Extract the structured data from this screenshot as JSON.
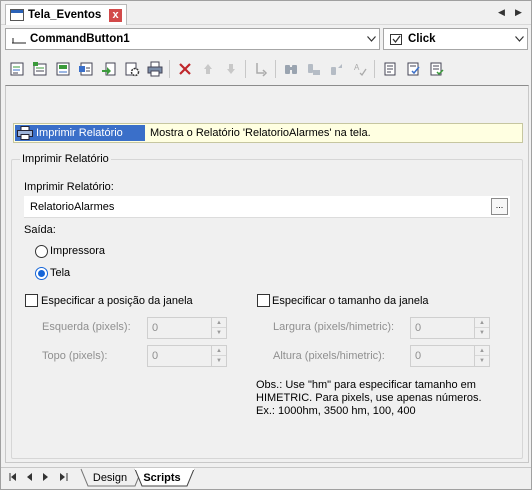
{
  "window": {
    "tab_title": "Tela_Eventos",
    "close_glyph": "x",
    "nav_prev": "◀",
    "nav_next": "▶"
  },
  "selectors": {
    "object": "CommandButton1",
    "event": "Click"
  },
  "toolbar": {
    "icons": [
      "add-script-icon",
      "add-user-script-icon",
      "add-action-icon",
      "add-item-icon",
      "import-icon",
      "settings-icon",
      "print-icon",
      "delete-icon",
      "move-up-icon",
      "move-down-icon",
      "goto-icon",
      "find-icon",
      "find-next-icon",
      "replace-icon",
      "spell-icon",
      "view-script-icon",
      "view-script-check-icon",
      "view-script-list-icon"
    ]
  },
  "action": {
    "name": "Imprimir Relatório",
    "description": "Mostra o Relatório 'RelatorioAlarmes' na tela."
  },
  "form": {
    "group_title": "Imprimir Relatório",
    "report_label": "Imprimir Relatório:",
    "report_value": "RelatorioAlarmes",
    "browse_label": "...",
    "output_label": "Saída:",
    "output_options": [
      {
        "label": "Impressora",
        "selected": false
      },
      {
        "label": "Tela",
        "selected": true
      }
    ],
    "position_check": {
      "label": "Especificar a posição da janela",
      "checked": false
    },
    "size_check": {
      "label": "Especificar o tamanho da janela",
      "checked": false
    },
    "left_label": "Esquerda (pixels):",
    "left_value": "0",
    "top_label": "Topo (pixels):",
    "top_value": "0",
    "width_label": "Largura (pixels/himetric):",
    "width_value": "0",
    "height_label": "Altura (pixels/himetric):",
    "height_value": "0",
    "note": "Obs.: Use \"hm\" para especificar tamanho em HIMETRIC. Para pixels, use apenas números.\nEx.: 1000hm, 3500 hm, 100, 400"
  },
  "bottom": {
    "tabs": [
      "Design",
      "Scripts"
    ],
    "active_tab": "Scripts"
  },
  "colors": {
    "selection": "#3a6fc9",
    "action_row_bg": "#ffffe1",
    "radio_accent": "#1565d8",
    "delete_red": "#c0262b"
  }
}
